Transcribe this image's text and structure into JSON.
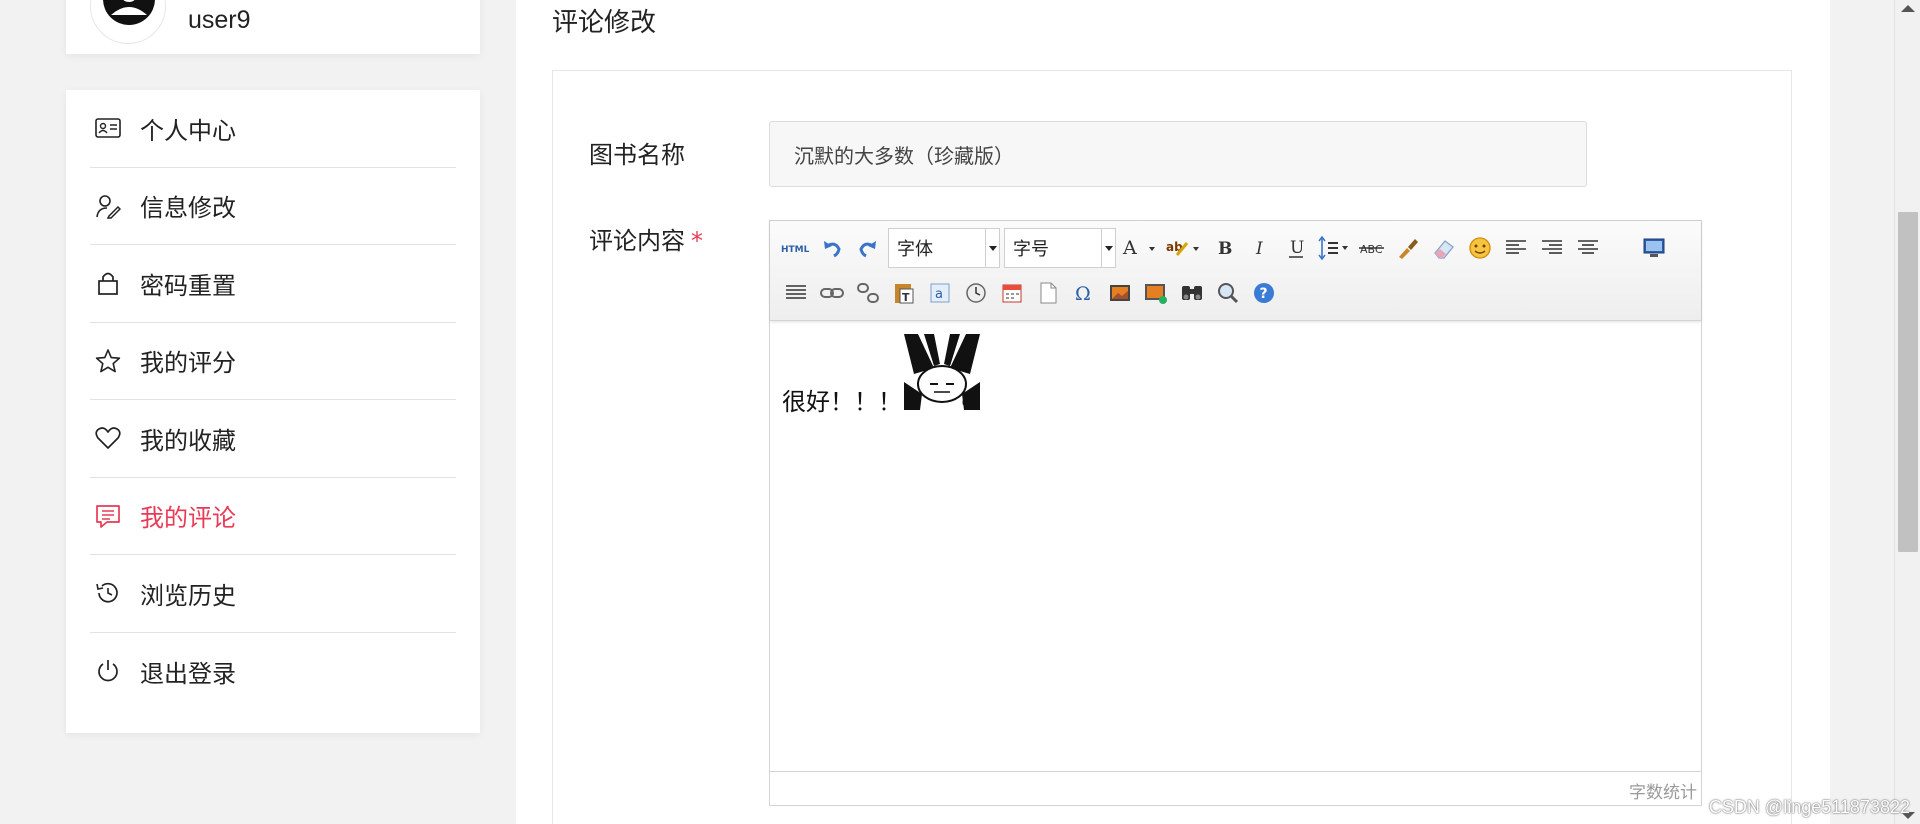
{
  "user": {
    "name": "user9"
  },
  "colors": {
    "accent": "#e83a55",
    "required": "#e83a55"
  },
  "sidebar": {
    "items": [
      {
        "label": "个人中心",
        "icon": "id-card-icon",
        "active": false
      },
      {
        "label": "信息修改",
        "icon": "user-edit-icon",
        "active": false
      },
      {
        "label": "密码重置",
        "icon": "lock-icon",
        "active": false
      },
      {
        "label": "我的评分",
        "icon": "star-icon",
        "active": false
      },
      {
        "label": "我的收藏",
        "icon": "heart-icon",
        "active": false
      },
      {
        "label": "我的评论",
        "icon": "comment-icon",
        "active": true
      },
      {
        "label": "浏览历史",
        "icon": "history-icon",
        "active": false
      },
      {
        "label": "退出登录",
        "icon": "power-icon",
        "active": false
      }
    ]
  },
  "main": {
    "title": "评论修改",
    "form": {
      "book_label": "图书名称",
      "book_value": "沉默的大多数（珍藏版）",
      "comment_label": "评论内容",
      "required_mark": "*"
    }
  },
  "editor": {
    "font_combo": "字体",
    "size_combo": "字号",
    "content_text": "很好！！！",
    "word_count_label": "字数统计",
    "toolbar_row1": [
      "html-source-icon",
      "undo-icon",
      "redo-icon",
      "font-family-select",
      "font-size-select",
      "font-color-icon",
      "highlight-color-icon",
      "bold-icon",
      "italic-icon",
      "underline-icon",
      "line-height-icon",
      "strikethrough-icon",
      "format-brush-icon",
      "eraser-icon",
      "emoticon-icon",
      "align-left-icon",
      "align-right-icon",
      "align-center-icon",
      "fullscreen-icon"
    ],
    "toolbar_row2": [
      "justify-icon",
      "link-icon",
      "unlink-icon",
      "paste-text-icon",
      "anchor-icon",
      "time-icon",
      "date-icon",
      "new-page-icon",
      "special-char-icon",
      "image-icon",
      "multi-image-icon",
      "find-replace-icon",
      "preview-icon",
      "help-icon"
    ]
  },
  "watermark": "CSDN @linge511873822"
}
